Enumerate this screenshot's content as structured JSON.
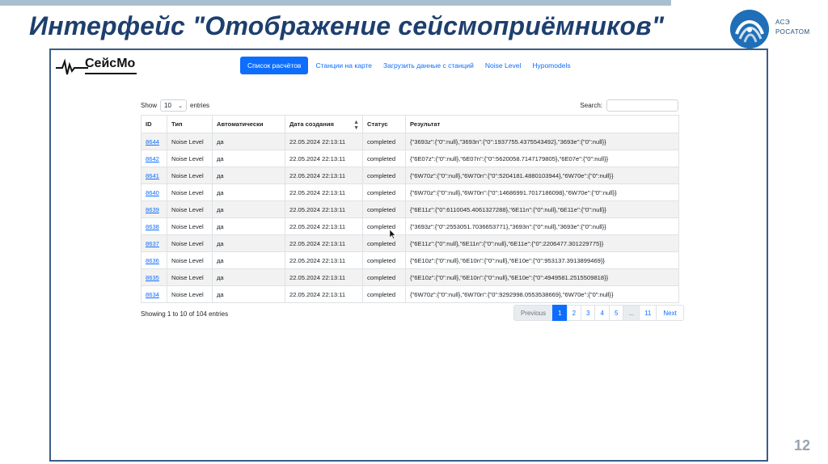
{
  "slide": {
    "title": "Интерфейс \"Отображение сейсмоприёмников\"",
    "logo_line1": "АСЭ",
    "logo_line2": "РОСАТОМ",
    "page_number": "12"
  },
  "app": {
    "brand": "СейсМо",
    "nav": [
      {
        "label": "Список расчётов",
        "active": true
      },
      {
        "label": "Станции на карте",
        "active": false
      },
      {
        "label": "Загрузить данные с станций",
        "active": false
      },
      {
        "label": "Noise Level",
        "active": false
      },
      {
        "label": "Hypomodels",
        "active": false
      }
    ],
    "table_controls": {
      "show_label": "Show",
      "entries_value": "10",
      "entries_label": "entries",
      "search_label": "Search:"
    },
    "columns": [
      "ID",
      "Тип",
      "Автоматически",
      "Дата создания",
      "Статус",
      "Результат"
    ],
    "rows": [
      {
        "id": "8644",
        "type": "Noise Level",
        "auto": "да",
        "date": "22.05.2024 22:13:11",
        "status": "completed",
        "result": "{\"3693z\":{\"0\":null},\"3693n\":{\"0\":1937755.4375543492},\"3693e\":{\"0\":null}}"
      },
      {
        "id": "8642",
        "type": "Noise Level",
        "auto": "да",
        "date": "22.05.2024 22:13:11",
        "status": "completed",
        "result": "{\"6E07z\":{\"0\":null},\"6E07n\":{\"0\":5620058.7147179805},\"6E07e\":{\"0\":null}}"
      },
      {
        "id": "8641",
        "type": "Noise Level",
        "auto": "да",
        "date": "22.05.2024 22:13:11",
        "status": "completed",
        "result": "{\"6W70z\":{\"0\":null},\"6W70n\":{\"0\":5204181.4880103944},\"6W70e\":{\"0\":null}}"
      },
      {
        "id": "8640",
        "type": "Noise Level",
        "auto": "да",
        "date": "22.05.2024 22:13:11",
        "status": "completed",
        "result": "{\"6W70z\":{\"0\":null},\"6W70n\":{\"0\":14686991.7017186098},\"6W70e\":{\"0\":null}}"
      },
      {
        "id": "8639",
        "type": "Noise Level",
        "auto": "да",
        "date": "22.05.2024 22:13:11",
        "status": "completed",
        "result": "{\"6E11z\":{\"0\":6110045.4061327288},\"6E11n\":{\"0\":null},\"6E11e\":{\"0\":null}}"
      },
      {
        "id": "8638",
        "type": "Noise Level",
        "auto": "да",
        "date": "22.05.2024 22:13:11",
        "status": "completed",
        "result": "{\"3693z\":{\"0\":2553051.7036653771},\"3693n\":{\"0\":null},\"3693e\":{\"0\":null}}"
      },
      {
        "id": "8637",
        "type": "Noise Level",
        "auto": "да",
        "date": "22.05.2024 22:13:11",
        "status": "completed",
        "result": "{\"6E11z\":{\"0\":null},\"6E11n\":{\"0\":null},\"6E11e\":{\"0\":2206477.301229775}}"
      },
      {
        "id": "8636",
        "type": "Noise Level",
        "auto": "да",
        "date": "22.05.2024 22:13:11",
        "status": "completed",
        "result": "{\"6E10z\":{\"0\":null},\"6E10n\":{\"0\":null},\"6E10e\":{\"0\":953137.3913899469}}"
      },
      {
        "id": "8635",
        "type": "Noise Level",
        "auto": "да",
        "date": "22.05.2024 22:13:11",
        "status": "completed",
        "result": "{\"6E10z\":{\"0\":null},\"6E10n\":{\"0\":null},\"6E10e\":{\"0\":4949581.2515509818}}"
      },
      {
        "id": "8634",
        "type": "Noise Level",
        "auto": "да",
        "date": "22.05.2024 22:13:11",
        "status": "completed",
        "result": "{\"6W70z\":{\"0\":null},\"6W70n\":{\"0\":9292998.0553538669},\"6W70e\":{\"0\":null}}"
      }
    ],
    "info": "Showing 1 to 10 of 104 entries",
    "pagination": {
      "previous": "Previous",
      "pages": [
        "1",
        "2",
        "3",
        "4",
        "5",
        "...",
        "11"
      ],
      "active_page": "1",
      "next": "Next"
    }
  },
  "colors": {
    "title": "#1d3f6e",
    "primary": "#0d6efd",
    "frame": "#3b5d86",
    "logo": "#1f6fb8"
  }
}
